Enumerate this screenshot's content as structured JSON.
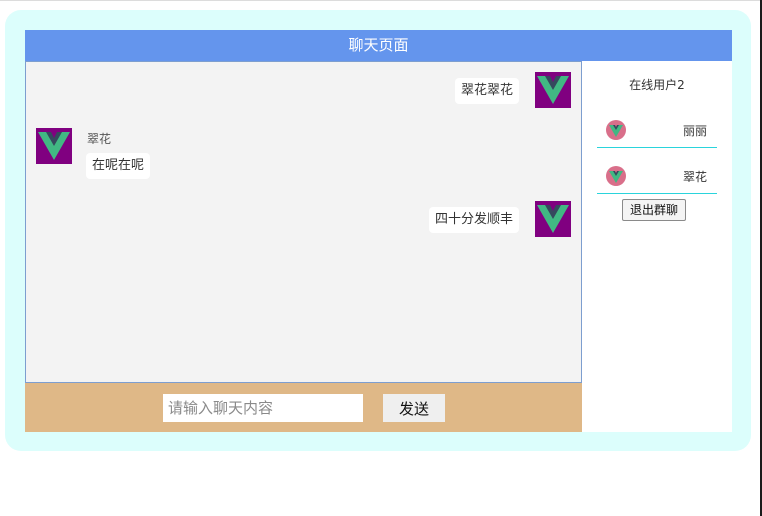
{
  "header": {
    "title": "聊天页面"
  },
  "messages": [
    {
      "sender": "",
      "side": "right",
      "text": "翠花翠花"
    },
    {
      "sender": "翠花",
      "side": "left",
      "text": "在呢在呢"
    },
    {
      "sender": "",
      "side": "right",
      "text": "四十分发顺丰"
    }
  ],
  "sidebar": {
    "online_label": "在线用户2",
    "users": [
      {
        "name": "丽丽"
      },
      {
        "name": "翠花"
      }
    ],
    "exit_label": "退出群聊"
  },
  "footer": {
    "input_value": "",
    "input_placeholder": "请输入聊天内容",
    "send_label": "发送"
  },
  "colors": {
    "outer_bg": "#dcfefc",
    "header_bg": "#6495ed",
    "chat_bg": "#f3f3f3",
    "footer_bg": "#dfb887",
    "avatar_bg": "#800080",
    "logo_green": "#41b883",
    "logo_dark": "#35495e",
    "user_avatar_bg": "#d96f8a",
    "divider": "#2ad4dc"
  },
  "icons": {
    "message_avatar": "vue-logo-icon",
    "user_avatar": "vue-logo-icon"
  }
}
